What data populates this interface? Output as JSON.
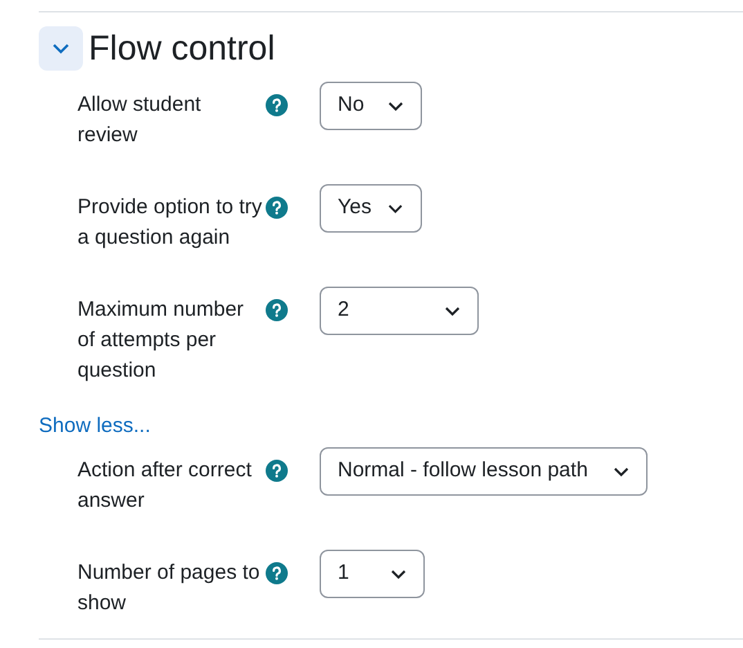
{
  "section": {
    "title": "Flow control",
    "expanded": true
  },
  "fields": [
    {
      "label": "Allow student review",
      "value": "No"
    },
    {
      "label": "Provide option to try a question again",
      "value": "Yes"
    },
    {
      "label": "Maximum number of attempts per question",
      "value": "2"
    }
  ],
  "toggle_link": "Show less...",
  "advanced_fields": [
    {
      "label": "Action after correct answer",
      "value": "Normal - follow lesson path"
    },
    {
      "label": "Number of pages to show",
      "value": "1"
    }
  ]
}
